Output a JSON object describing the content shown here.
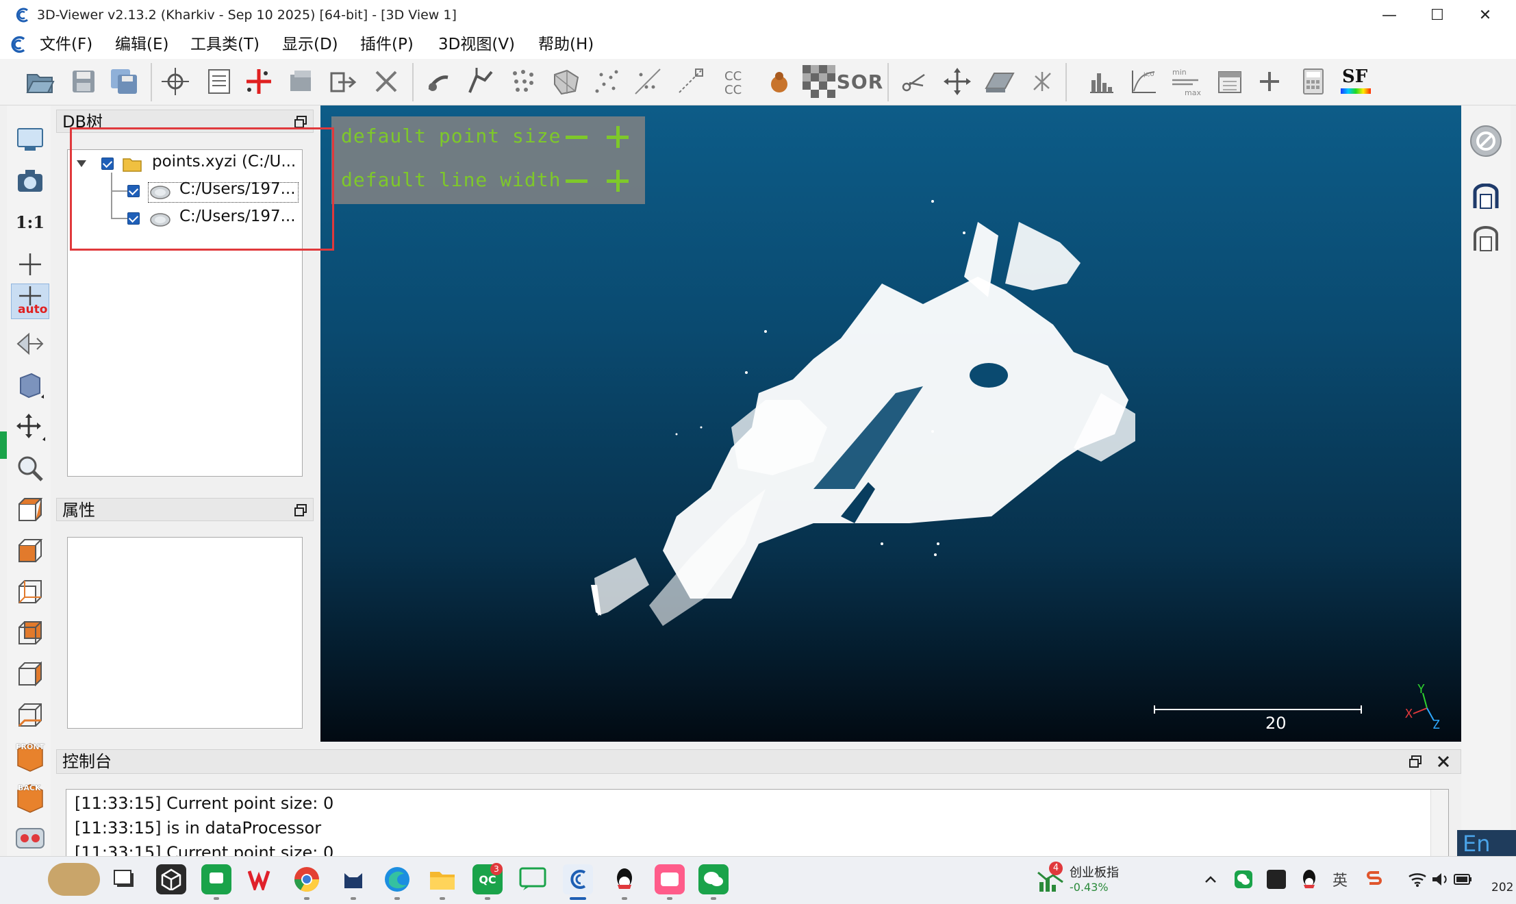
{
  "window": {
    "title": "3D-Viewer v2.13.2 (Kharkiv - Sep 10 2025) [64-bit] - [3D View 1]",
    "minimize": "—",
    "maximize": "☐",
    "close": "✕"
  },
  "menu": [
    "文件(F)",
    "编辑(E)",
    "工具类(T)",
    "显示(D)",
    "插件(P)",
    "3D视图(V)",
    "帮助(H)"
  ],
  "toolbar": {
    "cc_label": "CC\nCC",
    "sor_label": "SOR",
    "min_label": "min",
    "max_label": "max",
    "sf_label": "SF"
  },
  "left_toolbar": {
    "one_to_one": "1:1",
    "auto": "auto",
    "front": "FRONT",
    "back": "BACK"
  },
  "db_tree": {
    "title": "DB树",
    "root": "points.xyzi (C:/U...",
    "children": [
      "C:/Users/197...",
      "C:/Users/197..."
    ]
  },
  "properties": {
    "title": "属性"
  },
  "overlay": {
    "point_size": "default point size",
    "line_width": "default line width"
  },
  "view": {
    "scale_value": "20",
    "axis_x": "X",
    "axis_y": "Y",
    "axis_z": "Z"
  },
  "console": {
    "title": "控制台",
    "lines": [
      "[11:33:15] Current point size: 0",
      "[11:33:15] is in dataProcessor",
      "[11:33:15] Current point size: 0"
    ]
  },
  "ime": "En",
  "taskbar": {
    "badge_qc": "3",
    "stock_name": "创业板指",
    "stock_change": "-0.43%",
    "stock_badge": "4",
    "ime_lang": "英",
    "clock_partial": "202"
  },
  "colors": {
    "overlay_text": "#7ec82a",
    "highlight": "#e0393c",
    "view_top": "#0d5c88",
    "view_bottom": "#020a12",
    "stock_down": "#2a8a3a"
  }
}
